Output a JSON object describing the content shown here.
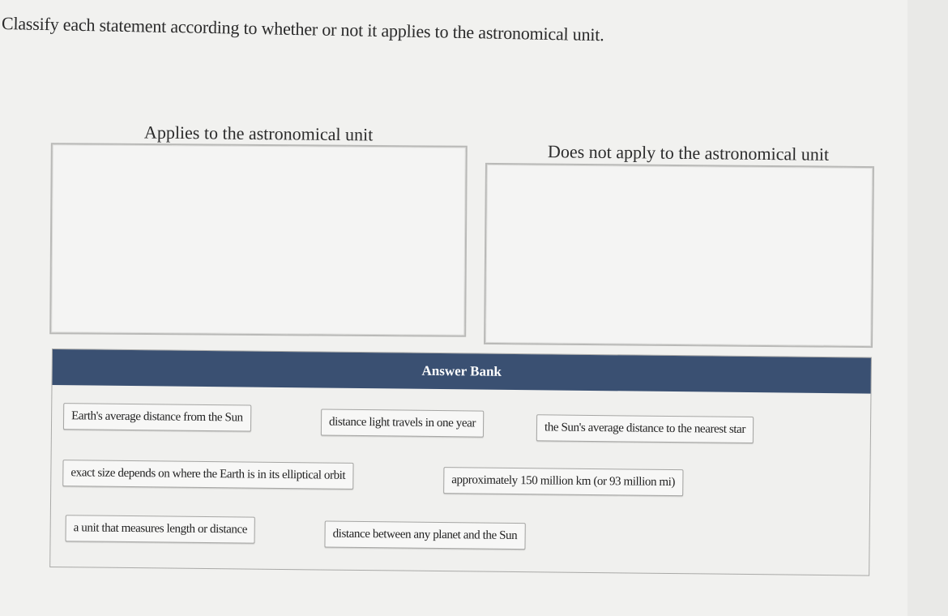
{
  "instruction": "Classify each statement according to whether or not it applies to the astronomical unit.",
  "zones": {
    "applies": {
      "label": "Applies to the astronomical unit"
    },
    "not_applies": {
      "label": "Does not apply to the astronomical unit"
    }
  },
  "answer_bank": {
    "title": "Answer Bank",
    "items": [
      "Earth's average distance from the Sun",
      "distance light travels in one year",
      "the Sun's average distance to the nearest star",
      "exact size depends on where the Earth is in its elliptical orbit",
      "approximately 150 million km (or 93 million mi)",
      "a unit that measures length or distance",
      "distance between any planet and the Sun"
    ]
  },
  "colors": {
    "bank_header": "#3a5072",
    "page_background": "#f1f1ef"
  }
}
